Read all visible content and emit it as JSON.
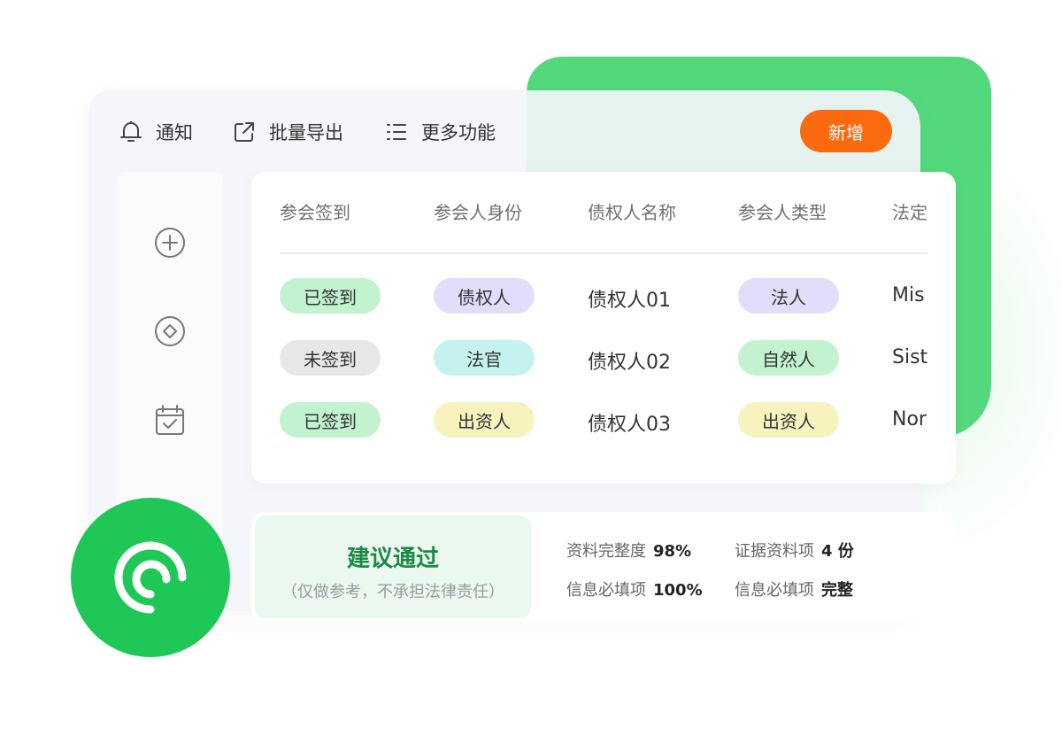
{
  "toolbar": {
    "notice": "通知",
    "export": "批量导出",
    "more": "更多功能",
    "new_button": "新增"
  },
  "table": {
    "headers": [
      "参会签到",
      "参会人身份",
      "债权人名称",
      "参会人类型",
      "法定"
    ],
    "rows": [
      {
        "checkin": "已签到",
        "identity": "债权人",
        "name": "债权人01",
        "type": "法人",
        "legal": "Mis"
      },
      {
        "checkin": "未签到",
        "identity": "法官",
        "name": "债权人02",
        "type": "自然人",
        "legal": "Sist"
      },
      {
        "checkin": "已签到",
        "identity": "出资人",
        "name": "债权人03",
        "type": "出资人",
        "legal": "Nor"
      }
    ]
  },
  "result": {
    "title": "建议通过",
    "subtitle": "（仅做参考，不承担法律责任）",
    "metrics": [
      {
        "label": "资料完整度",
        "value": "98%"
      },
      {
        "label": "证据资料项",
        "value": "4 份"
      },
      {
        "label": "信息必填项",
        "value": "100%"
      },
      {
        "label": "信息必填项",
        "value": "完整"
      }
    ]
  },
  "colors": {
    "accent_orange": "#fb6a0f",
    "brand_green": "#1ec756",
    "pill_green": "#c3f2d0",
    "pill_gray": "#e7e7ea",
    "pill_purple": "#e3dcfb",
    "pill_cyan": "#c4f3ef",
    "pill_yellow": "#f6f3be"
  },
  "icons": {
    "notice": "bell-icon",
    "export": "external-link-icon",
    "more": "list-icon",
    "sidebar": [
      "plus-circle-icon",
      "diamond-circle-icon",
      "calendar-check-icon"
    ],
    "logo": "swirl-logo-icon"
  }
}
